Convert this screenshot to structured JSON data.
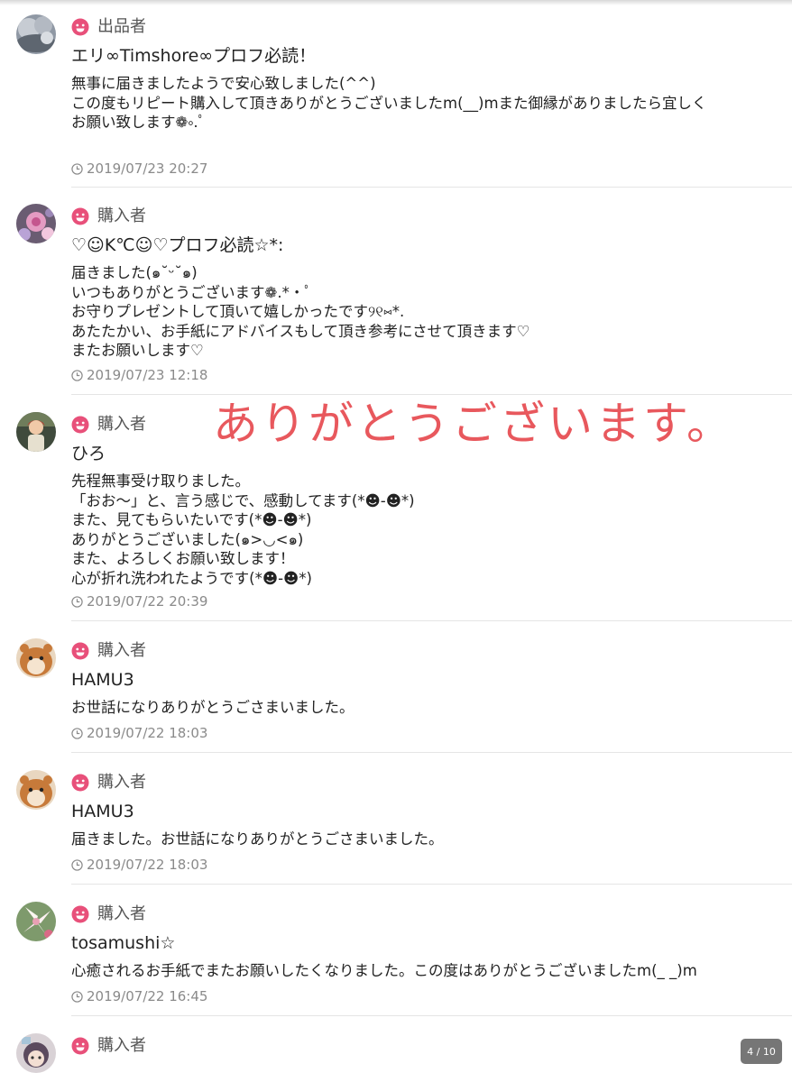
{
  "colors": {
    "role_icon": "#e8507a",
    "overlay_text": "#e8585d",
    "date_text": "#8a8a8a",
    "divider": "#e5e5e5"
  },
  "icons": {
    "role": "smile-face-icon",
    "date": "clock-icon"
  },
  "overlay": {
    "text": "ありがとうございます。"
  },
  "pager": {
    "text": "4 / 10"
  },
  "reviews": [
    {
      "role": "出品者",
      "username": "エリ∞Timshore∞プロフ必読！",
      "message": "無事に届きましたようで安心致しました(^^)\nこの度もリピート購入して頂きありがとうございましたm(__)mまた御縁がありましたら宜しく\nお願い致します❁༚.ﾟ",
      "date": "2019/07/23 20:27",
      "avatar": "gray-clouds"
    },
    {
      "role": "購入者",
      "username": "♡☺K℃☺♡プロフ必読☆*:",
      "message": "届きました(๑˘ᵕ˘๑)\nいつもありがとうございます❁.*・ﾟ\nお守りプレゼントして頂いて嬉しかったです୨୧⑅*.\nあたたかい、お手紙にアドバイスもして頂き参考にさせて頂きます♡\nまたお願いします♡",
      "date": "2019/07/23 12:18",
      "avatar": "pink-flowers"
    },
    {
      "role": "購入者",
      "username": "ひろ",
      "message": "先程無事受け取りました。\n「おお〜」と、言う感じで、感動してます(*☻-☻*)\nまた、見てもらいたいです(*☻-☻*)\nありがとうございました(๑>◡<๑)\nまた、よろしくお願い致します！\n心が折れ洗われたようです(*☻-☻*)",
      "date": "2019/07/22 20:39",
      "avatar": "person-photo"
    },
    {
      "role": "購入者",
      "username": "HAMU3",
      "message": "お世話になりありがとうごさまいました。",
      "date": "2019/07/22 18:03",
      "avatar": "hamster"
    },
    {
      "role": "購入者",
      "username": "HAMU3",
      "message": "届きました。お世話になりありがとうごさまいました。",
      "date": "2019/07/22 18:03",
      "avatar": "hamster"
    },
    {
      "role": "購入者",
      "username": "tosamushi☆",
      "message": "心癒されるお手紙でまたお願いしたくなりました。この度はありがとうございましたm(_ _)m",
      "date": "2019/07/22 16:45",
      "avatar": "white-lily"
    },
    {
      "role": "購入者",
      "username": "",
      "message": "",
      "date": "",
      "avatar": "cartoon-character"
    }
  ]
}
